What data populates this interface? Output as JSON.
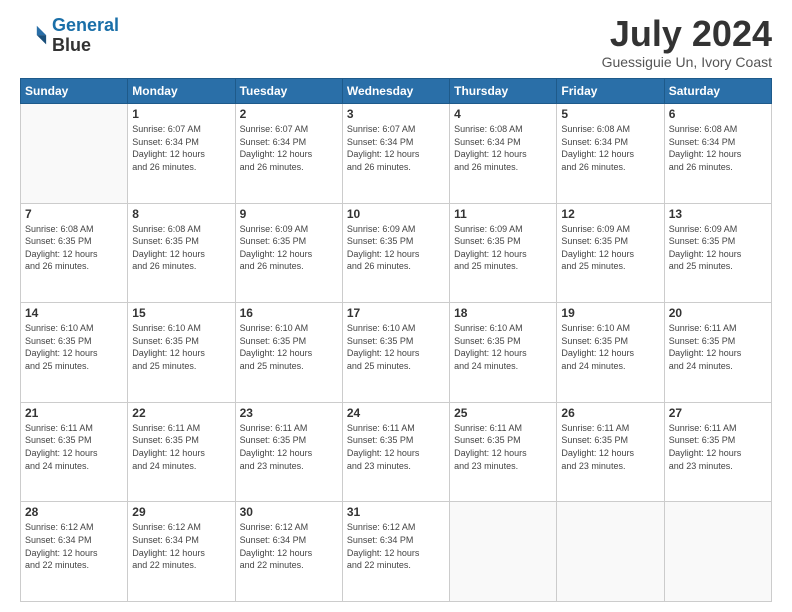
{
  "header": {
    "logo_line1": "General",
    "logo_line2": "Blue",
    "month": "July 2024",
    "location": "Guessiguie Un, Ivory Coast"
  },
  "weekdays": [
    "Sunday",
    "Monday",
    "Tuesday",
    "Wednesday",
    "Thursday",
    "Friday",
    "Saturday"
  ],
  "weeks": [
    [
      {
        "day": "",
        "info": ""
      },
      {
        "day": "1",
        "info": "Sunrise: 6:07 AM\nSunset: 6:34 PM\nDaylight: 12 hours\nand 26 minutes."
      },
      {
        "day": "2",
        "info": "Sunrise: 6:07 AM\nSunset: 6:34 PM\nDaylight: 12 hours\nand 26 minutes."
      },
      {
        "day": "3",
        "info": "Sunrise: 6:07 AM\nSunset: 6:34 PM\nDaylight: 12 hours\nand 26 minutes."
      },
      {
        "day": "4",
        "info": "Sunrise: 6:08 AM\nSunset: 6:34 PM\nDaylight: 12 hours\nand 26 minutes."
      },
      {
        "day": "5",
        "info": "Sunrise: 6:08 AM\nSunset: 6:34 PM\nDaylight: 12 hours\nand 26 minutes."
      },
      {
        "day": "6",
        "info": "Sunrise: 6:08 AM\nSunset: 6:34 PM\nDaylight: 12 hours\nand 26 minutes."
      }
    ],
    [
      {
        "day": "7",
        "info": "Sunrise: 6:08 AM\nSunset: 6:35 PM\nDaylight: 12 hours\nand 26 minutes."
      },
      {
        "day": "8",
        "info": "Sunrise: 6:08 AM\nSunset: 6:35 PM\nDaylight: 12 hours\nand 26 minutes."
      },
      {
        "day": "9",
        "info": "Sunrise: 6:09 AM\nSunset: 6:35 PM\nDaylight: 12 hours\nand 26 minutes."
      },
      {
        "day": "10",
        "info": "Sunrise: 6:09 AM\nSunset: 6:35 PM\nDaylight: 12 hours\nand 26 minutes."
      },
      {
        "day": "11",
        "info": "Sunrise: 6:09 AM\nSunset: 6:35 PM\nDaylight: 12 hours\nand 25 minutes."
      },
      {
        "day": "12",
        "info": "Sunrise: 6:09 AM\nSunset: 6:35 PM\nDaylight: 12 hours\nand 25 minutes."
      },
      {
        "day": "13",
        "info": "Sunrise: 6:09 AM\nSunset: 6:35 PM\nDaylight: 12 hours\nand 25 minutes."
      }
    ],
    [
      {
        "day": "14",
        "info": "Sunrise: 6:10 AM\nSunset: 6:35 PM\nDaylight: 12 hours\nand 25 minutes."
      },
      {
        "day": "15",
        "info": "Sunrise: 6:10 AM\nSunset: 6:35 PM\nDaylight: 12 hours\nand 25 minutes."
      },
      {
        "day": "16",
        "info": "Sunrise: 6:10 AM\nSunset: 6:35 PM\nDaylight: 12 hours\nand 25 minutes."
      },
      {
        "day": "17",
        "info": "Sunrise: 6:10 AM\nSunset: 6:35 PM\nDaylight: 12 hours\nand 25 minutes."
      },
      {
        "day": "18",
        "info": "Sunrise: 6:10 AM\nSunset: 6:35 PM\nDaylight: 12 hours\nand 24 minutes."
      },
      {
        "day": "19",
        "info": "Sunrise: 6:10 AM\nSunset: 6:35 PM\nDaylight: 12 hours\nand 24 minutes."
      },
      {
        "day": "20",
        "info": "Sunrise: 6:11 AM\nSunset: 6:35 PM\nDaylight: 12 hours\nand 24 minutes."
      }
    ],
    [
      {
        "day": "21",
        "info": "Sunrise: 6:11 AM\nSunset: 6:35 PM\nDaylight: 12 hours\nand 24 minutes."
      },
      {
        "day": "22",
        "info": "Sunrise: 6:11 AM\nSunset: 6:35 PM\nDaylight: 12 hours\nand 24 minutes."
      },
      {
        "day": "23",
        "info": "Sunrise: 6:11 AM\nSunset: 6:35 PM\nDaylight: 12 hours\nand 23 minutes."
      },
      {
        "day": "24",
        "info": "Sunrise: 6:11 AM\nSunset: 6:35 PM\nDaylight: 12 hours\nand 23 minutes."
      },
      {
        "day": "25",
        "info": "Sunrise: 6:11 AM\nSunset: 6:35 PM\nDaylight: 12 hours\nand 23 minutes."
      },
      {
        "day": "26",
        "info": "Sunrise: 6:11 AM\nSunset: 6:35 PM\nDaylight: 12 hours\nand 23 minutes."
      },
      {
        "day": "27",
        "info": "Sunrise: 6:11 AM\nSunset: 6:35 PM\nDaylight: 12 hours\nand 23 minutes."
      }
    ],
    [
      {
        "day": "28",
        "info": "Sunrise: 6:12 AM\nSunset: 6:34 PM\nDaylight: 12 hours\nand 22 minutes."
      },
      {
        "day": "29",
        "info": "Sunrise: 6:12 AM\nSunset: 6:34 PM\nDaylight: 12 hours\nand 22 minutes."
      },
      {
        "day": "30",
        "info": "Sunrise: 6:12 AM\nSunset: 6:34 PM\nDaylight: 12 hours\nand 22 minutes."
      },
      {
        "day": "31",
        "info": "Sunrise: 6:12 AM\nSunset: 6:34 PM\nDaylight: 12 hours\nand 22 minutes."
      },
      {
        "day": "",
        "info": ""
      },
      {
        "day": "",
        "info": ""
      },
      {
        "day": "",
        "info": ""
      }
    ]
  ]
}
